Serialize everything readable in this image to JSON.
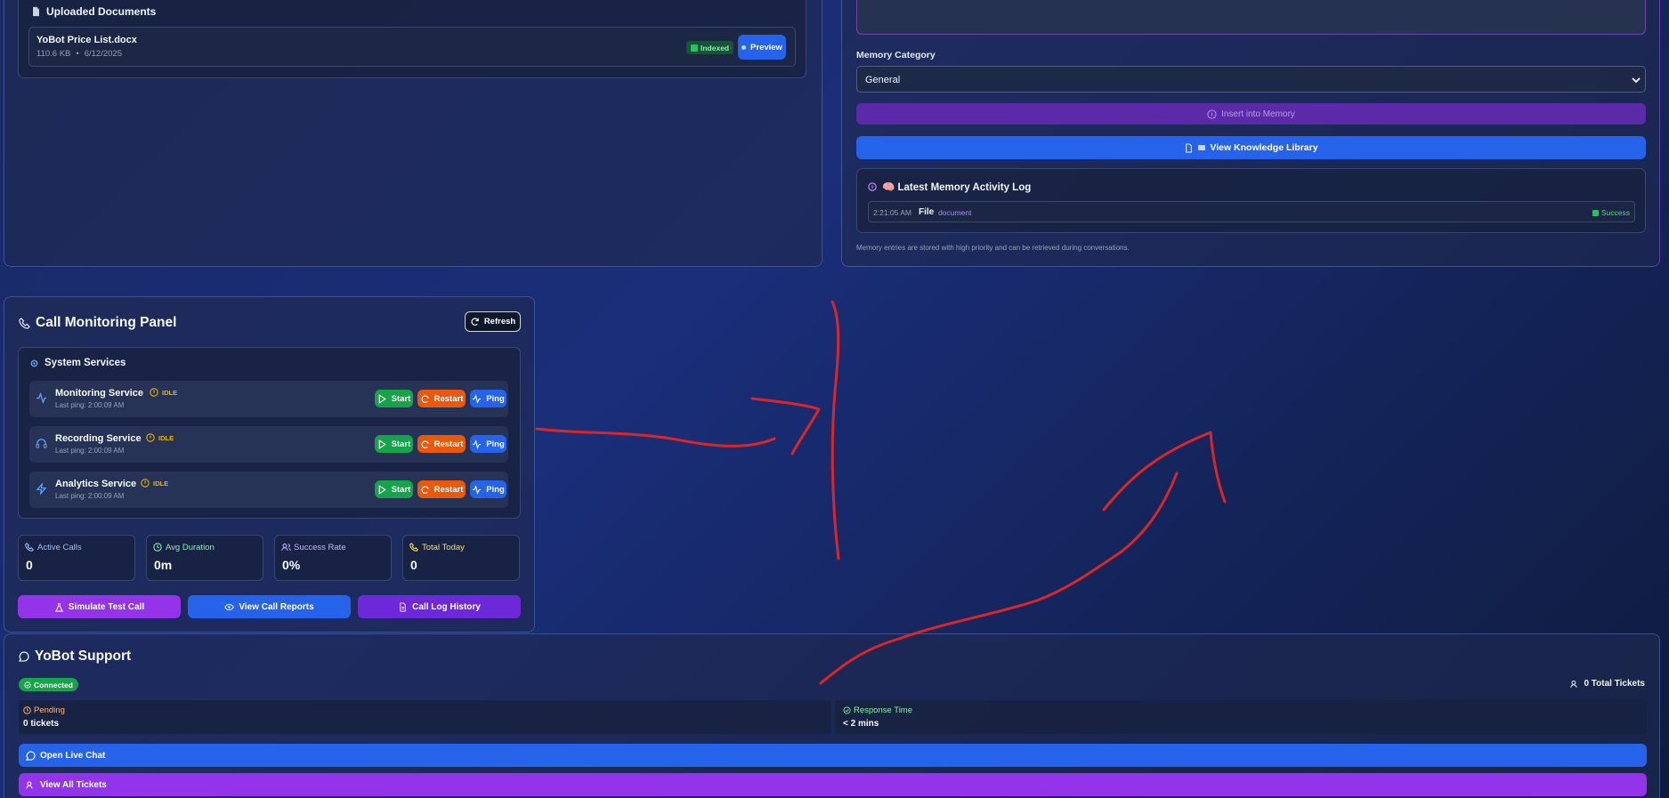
{
  "uploaded_documents": {
    "title": "Uploaded Documents",
    "files": [
      {
        "name": "YoBot Price List.docx",
        "size": "110.6 KB",
        "date": "6/12/2025",
        "status": "Indexed",
        "action": "Preview"
      }
    ]
  },
  "memory": {
    "category_label": "Memory Category",
    "category_value": "General",
    "insert_button": "Insert into Memory",
    "library_button": "View Knowledge Library",
    "log_title": "🧠 Latest Memory Activity Log",
    "log_entries": [
      {
        "time": "2:21:05 AM",
        "type": "File",
        "tag": "document",
        "status": "Success"
      }
    ],
    "footnote": "Memory entries are stored with high priority and can be retrieved during conversations."
  },
  "call_monitoring": {
    "title": "Call Monitoring Panel",
    "refresh": "Refresh",
    "services_title": "System Services",
    "services": [
      {
        "name": "Monitoring Service",
        "status": "IDLE",
        "last_ping": "Last ping: 2:00:09 AM",
        "icon": "activity-icon"
      },
      {
        "name": "Recording Service",
        "status": "IDLE",
        "last_ping": "Last ping: 2:00:09 AM",
        "icon": "headphones-icon"
      },
      {
        "name": "Analytics Service",
        "status": "IDLE",
        "last_ping": "Last ping: 2:00:09 AM",
        "icon": "zap-icon"
      }
    ],
    "start_label": "Start",
    "restart_label": "Restart",
    "ping_label": "Ping",
    "stats": [
      {
        "label": "Active Calls",
        "value": "0",
        "color": "#93c5fd"
      },
      {
        "label": "Avg Duration",
        "value": "0m",
        "color": "#86efac"
      },
      {
        "label": "Success Rate",
        "value": "0%",
        "color": "#c4b5fd"
      },
      {
        "label": "Total Today",
        "value": "0",
        "color": "#fde047"
      }
    ],
    "actions": {
      "simulate": "Simulate Test Call",
      "reports": "View Call Reports",
      "history": "Call Log History"
    }
  },
  "support": {
    "title": "YoBot Support",
    "connection": "Connected",
    "total_tickets": "0 Total Tickets",
    "pending_label": "Pending",
    "pending_value": "0 tickets",
    "response_label": "Response Time",
    "response_value": "< 2 mins",
    "live_chat": "Open Live Chat",
    "all_tickets": "View All Tickets"
  },
  "colors": {
    "green": "#16a34a",
    "orange": "#ea580c",
    "blue": "#2563eb",
    "purple": "#9333ea",
    "annotation_red": "#dc2626"
  }
}
